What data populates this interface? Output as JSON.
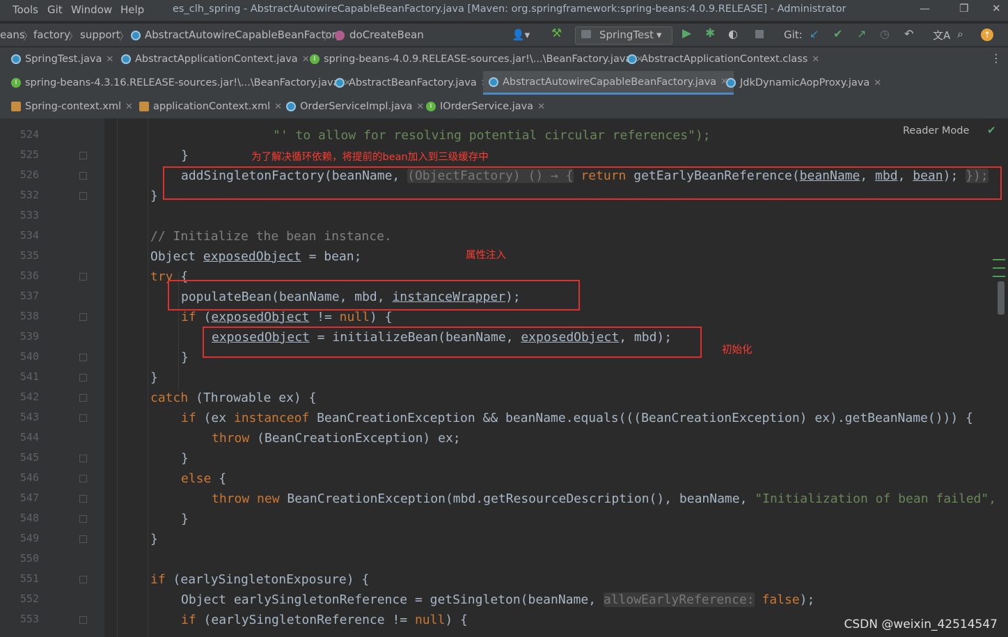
{
  "menu": [
    "Tools",
    "Git",
    "Window",
    "Help"
  ],
  "window_title": "es_clh_spring - AbstractAutowireCapableBeanFactory.java [Maven: org.springframework:spring-beans:4.0.9.RELEASE] - Administrator",
  "breadcrumb": [
    "eans",
    "factory",
    "support",
    "AbstractAutowireCapableBeanFactory",
    "doCreateBean"
  ],
  "run_config": "SpringTest",
  "git_label": "Git:",
  "tabs_row1": [
    "SpringTest.java",
    "AbstractApplicationContext.java",
    "spring-beans-4.0.9.RELEASE-sources.jar!\\...\\BeanFactory.java",
    "AbstractApplicationContext.class"
  ],
  "tabs_row2": [
    "spring-beans-4.3.16.RELEASE-sources.jar!\\...\\BeanFactory.java",
    "AbstractBeanFactory.java",
    "AbstractAutowireCapableBeanFactory.java",
    "JdkDynamicAopProxy.java"
  ],
  "tabs_row3": [
    "Spring-context.xml",
    "applicationContext.xml",
    "OrderServiceImpl.java",
    "IOrderService.java"
  ],
  "line_numbers": [
    "524",
    "525",
    "526",
    "532",
    "533",
    "534",
    "535",
    "536",
    "537",
    "538",
    "539",
    "540",
    "541",
    "542",
    "543",
    "544",
    "545",
    "546",
    "547",
    "548",
    "549",
    "550",
    "551",
    "552",
    "553"
  ],
  "reader_mode": "Reader Mode",
  "annotations": {
    "cache": "为了解决循环依赖，将提前的bean加入到三级缓存中",
    "populate": "属性注入",
    "init": "初始化"
  },
  "watermark": "CSDN @weixin_42514547",
  "code": {
    "l524": "\"' to allow for resolving potential circular references\");",
    "l525": "}",
    "l526_fn": "addSingletonFactory(beanName, ",
    "l526_hint": "(ObjectFactory) () → {",
    "l526_ret": "return",
    "l526_call": " getEarlyBeanReference(",
    "l526_a1": "beanName",
    "l526_sep1": ", ",
    "l526_a2": "mbd",
    "l526_sep2": ", ",
    "l526_a3": "bean",
    "l526_end": "); ",
    "l526_close": "});",
    "l532": "}",
    "l534": "// Initialize the bean instance.",
    "l535_a": "Object ",
    "l535_b": "exposedObject",
    "l535_c": " = bean;",
    "l536_kw": "try",
    "l536_b": " {",
    "l537_a": "populateBean(beanName, mbd, ",
    "l537_b": "instanceWrapper",
    "l537_c": ");",
    "l538_kw": "if",
    "l538_a": " (",
    "l538_b": "exposedObject",
    "l538_c": " != ",
    "l538_null": "null",
    "l538_d": ") {",
    "l539_a": "exposedObject",
    "l539_b": " = initializeBean(beanName, ",
    "l539_c": "exposedObject",
    "l539_d": ", mbd);",
    "l540": "}",
    "l541": "}",
    "l542_kw": "catch",
    "l542_a": " (Throwable ex) {",
    "l543_kw": "if",
    "l543_a": " (ex ",
    "l543_kw2": "instanceof",
    "l543_b": " BeanCreationException && beanName.equals(((BeanCreationException) ex).getBeanName())) {",
    "l544_kw": "throw",
    "l544_a": " (BeanCreationException) ex;",
    "l545": "}",
    "l546_kw": "else",
    "l546_a": " {",
    "l547_kw": "throw",
    "l547_kw2": " new",
    "l547_a": " BeanCreationException(mbd.getResourceDescription(), beanName, ",
    "l547_str": "\"Initialization of bean failed\",",
    "l548": "}",
    "l549": "}",
    "l551_kw": "if",
    "l551_a": " (earlySingletonExposure) {",
    "l552_a": "Object earlySingletonReference = getSingleton(beanName, ",
    "l552_hint": "allowEarlyReference:",
    "l552_kw": " false",
    "l552_b": ");",
    "l553_kw": "if",
    "l553_a": " (earlySingletonReference != ",
    "l553_null": "null",
    "l553_b": ") {"
  }
}
